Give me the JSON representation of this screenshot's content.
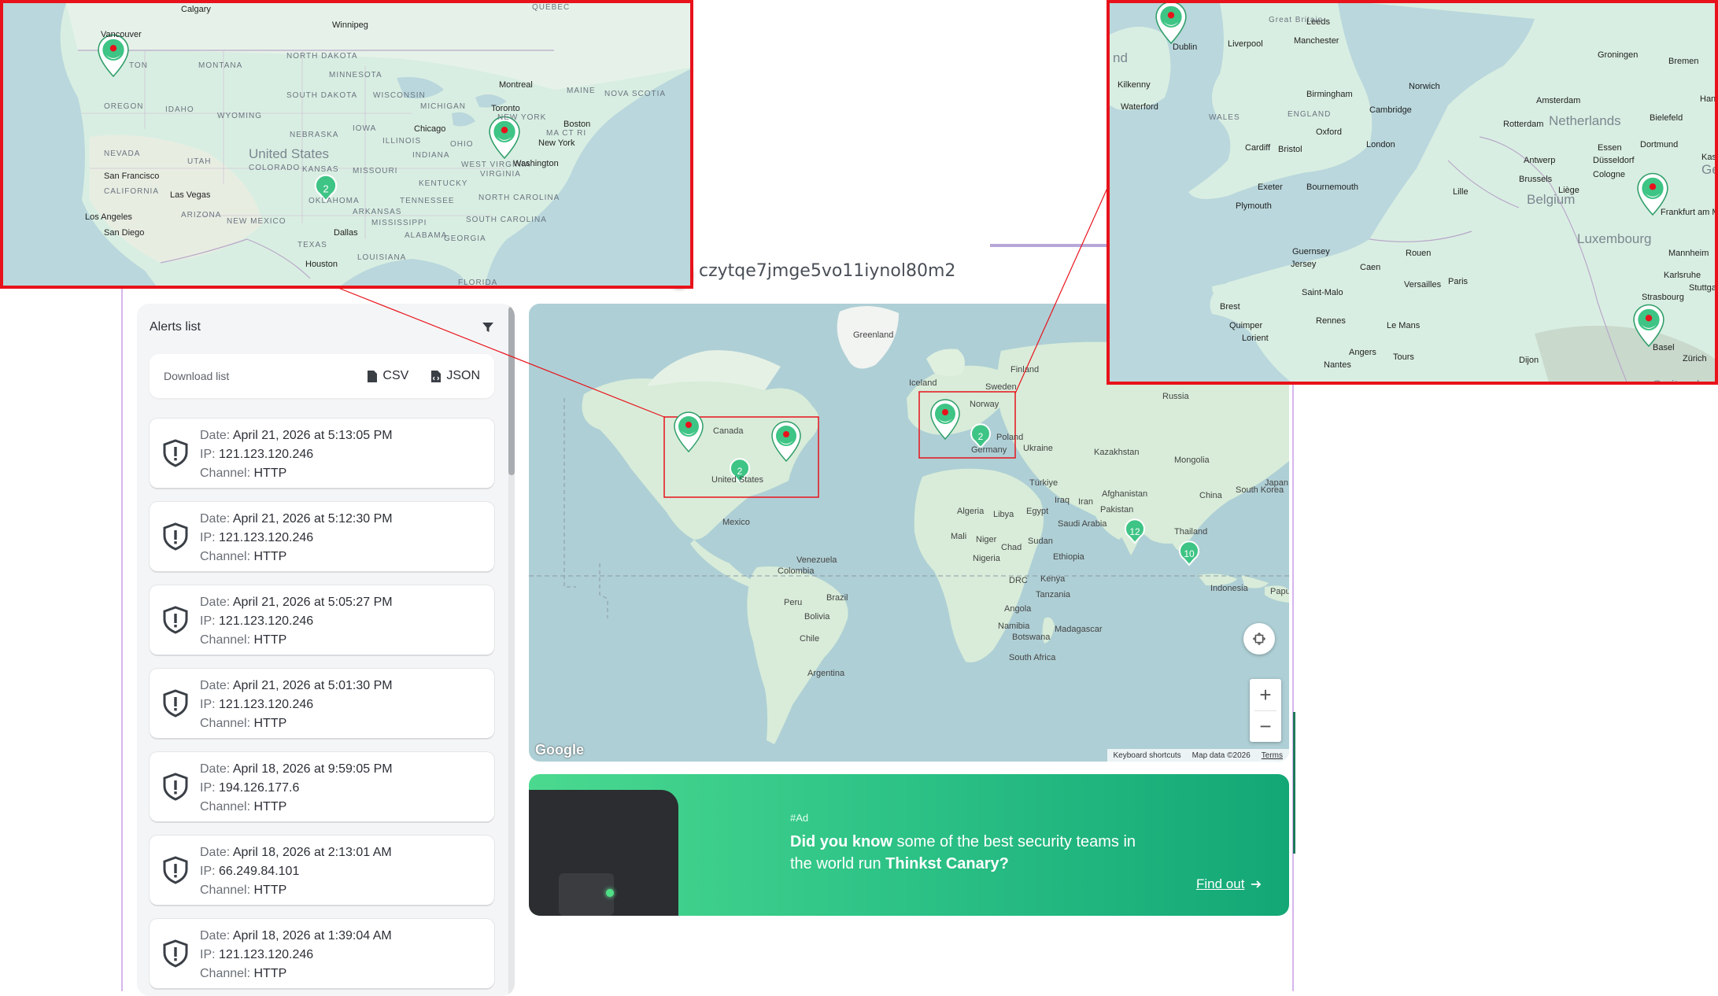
{
  "token": {
    "title": "czytqe7jmge5vo11iynol80m2"
  },
  "sidebar": {
    "title": "Alerts list",
    "download_label": "Download list",
    "csv_label": "CSV",
    "json_label": "JSON"
  },
  "alerts": [
    {
      "date": "April 21, 2026 at 5:13:05 PM",
      "ip": "121.123.120.246",
      "channel": "HTTP"
    },
    {
      "date": "April 21, 2026 at 5:12:30 PM",
      "ip": "121.123.120.246",
      "channel": "HTTP"
    },
    {
      "date": "April 21, 2026 at 5:05:27 PM",
      "ip": "121.123.120.246",
      "channel": "HTTP"
    },
    {
      "date": "April 21, 2026 at 5:01:30 PM",
      "ip": "121.123.120.246",
      "channel": "HTTP"
    },
    {
      "date": "April 18, 2026 at 9:59:05 PM",
      "ip": "194.126.177.6",
      "channel": "HTTP"
    },
    {
      "date": "April 18, 2026 at 2:13:01 AM",
      "ip": "66.249.84.101",
      "channel": "HTTP"
    },
    {
      "date": "April 18, 2026 at 1:39:04 AM",
      "ip": "121.123.120.246",
      "channel": "HTTP"
    }
  ],
  "alert_labels": {
    "date": "Date:",
    "ip": "IP:",
    "channel": "Channel:"
  },
  "map": {
    "footer_shortcuts": "Keyboard shortcuts",
    "footer_data": "Map data ©2026",
    "footer_terms": "Terms",
    "google": "Google",
    "zoom_in": "+",
    "zoom_out": "−",
    "clusters": [
      "2",
      "2",
      "12",
      "10"
    ],
    "labels": {
      "greenland": "Greenland",
      "iceland": "Iceland",
      "sweden": "Sweden",
      "finland": "Finland",
      "norway": "Norway",
      "russia": "Russia",
      "canada": "Canada",
      "united_states": "United States",
      "mexico": "Mexico",
      "kazakhstan": "Kazakhstan",
      "mongolia": "Mongolia",
      "ukraine": "Ukraine",
      "poland": "Poland",
      "germany": "Germany",
      "turkiye": "Türkiye",
      "iraq": "Iraq",
      "iran": "Iran",
      "afghanistan": "Afghanistan",
      "pakistan": "Pakistan",
      "china": "China",
      "south_korea": "South Korea",
      "japan": "Japan",
      "algeria": "Algeria",
      "libya": "Libya",
      "egypt": "Egypt",
      "saudi_arabia": "Saudi Arabia",
      "mali": "Mali",
      "niger": "Niger",
      "chad": "Chad",
      "sudan": "Sudan",
      "nigeria": "Nigeria",
      "ethiopia": "Ethiopia",
      "thailand": "Thailand",
      "venezuela": "Venezuela",
      "colombia": "Colombia",
      "peru": "Peru",
      "brazil": "Brazil",
      "bolivia": "Bolivia",
      "chile": "Chile",
      "argentina": "Argentina",
      "drc": "DRC",
      "kenya": "Kenya",
      "tanzania": "Tanzania",
      "angola": "Angola",
      "namibia": "Namibia",
      "botswana": "Botswana",
      "south_africa": "South Africa",
      "madagascar": "Madagascar",
      "indonesia": "Indonesia",
      "papua": "Papua"
    }
  },
  "inset_us": {
    "clusters": [
      "2"
    ],
    "labels": {
      "calgary": "Calgary",
      "winnipeg": "Winnipeg",
      "vancouver": "Vancouver",
      "quebec": "QUÉBEC",
      "north_dakota": "NORTH DAKOTA",
      "montana": "MONTANA",
      "minnesota": "MINNESOTA",
      "south_dakota": "SOUTH DAKOTA",
      "wisconsin": "WISCONSIN",
      "michigan": "MICHIGAN",
      "montreal": "Montreal",
      "maine": "MAINE",
      "nova_scotia": "NOVA SCOTIA",
      "oregon": "OREGON",
      "idaho": "IDAHO",
      "wyoming": "WYOMING",
      "toronto": "Toronto",
      "new_york_state": "NEW YORK",
      "boston": "Boston",
      "iowa": "IOWA",
      "chicago": "Chicago",
      "nebraska": "NEBRASKA",
      "illinois": "ILLINOIS",
      "ohio": "OHIO",
      "ma_ct_ri": "MA CT RI",
      "new_york": "New York",
      "nevada": "NEVADA",
      "utah": "UTAH",
      "colorado": "COLORADO",
      "united_states": "United States",
      "kansas": "KANSAS",
      "missouri": "MISSOURI",
      "indiana": "INDIANA",
      "west_virginia": "WEST VIRGINIA",
      "washington": "Washington",
      "virginia": "VIRGINIA",
      "san_francisco": "San Francisco",
      "california": "CALIFORNIA",
      "las_vegas": "Las Vegas",
      "oklahoma": "OKLAHOMA",
      "kentucky": "KENTUCKY",
      "tennessee": "TENNESSEE",
      "north_carolina": "NORTH CAROLINA",
      "arizona": "ARIZONA",
      "los_angeles": "Los Angeles",
      "new_mexico": "NEW MEXICO",
      "arkansas": "ARKANSAS",
      "mississippi": "MISSISSIPPI",
      "south_carolina": "SOUTH CAROLINA",
      "san_diego": "San Diego",
      "dallas": "Dallas",
      "alabama": "ALABAMA",
      "georgia": "GEORGIA",
      "texas": "TEXAS",
      "houston": "Houston",
      "louisiana": "LOUISIANA",
      "ton": "TON",
      "florida": "FLORIDA"
    }
  },
  "inset_eu": {
    "labels": {
      "leeds": "Leeds",
      "great_britain": "Great Britain",
      "dublin": "Dublin",
      "liverpool": "Liverpool",
      "manchester": "Manchester",
      "groningen": "Groningen",
      "bremen": "Bremen",
      "ireland_frag": "nd",
      "kilkenny": "Kilkenny",
      "norwich": "Norwich",
      "birmingham": "Birmingham",
      "amsterdam": "Amsterdam",
      "waterford": "Waterford",
      "cambridge": "Cambridge",
      "netherlands": "Netherlands",
      "wales": "WALES",
      "england": "ENGLAND",
      "rotterdam": "Rotterdam",
      "bielefeld": "Bielefeld",
      "oxford": "Oxford",
      "essen": "Essen",
      "dortmund": "Dortmund",
      "cardiff": "Cardiff",
      "bristol": "Bristol",
      "london": "London",
      "antwerp": "Antwerp",
      "dusseldorf": "Düsseldorf",
      "kassel": "Kassel",
      "brussels": "Brussels",
      "cologne": "Cologne",
      "germ_frag": "Germ",
      "exeter": "Exeter",
      "bournemouth": "Bournemouth",
      "lille": "Lille",
      "liege": "Liège",
      "belgium": "Belgium",
      "frankfurt": "Frankfurt am Main",
      "plymouth": "Plymouth",
      "luxembourg": "Luxembourg",
      "guernsey": "Guernsey",
      "jersey": "Jersey",
      "caen": "Caen",
      "rouen": "Rouen",
      "mannheim": "Mannheim",
      "karlsruhe": "Karlsruhe",
      "versailles": "Versailles",
      "paris": "Paris",
      "stuttgart": "Stuttgart",
      "saint_malo": "Saint-Malo",
      "strasbourg": "Strasbourg",
      "brest": "Brest",
      "rennes": "Rennes",
      "quimper": "Quimper",
      "le_mans": "Le Mans",
      "lorient": "Lorient",
      "basel": "Basel",
      "angers": "Angers",
      "tours": "Tours",
      "zurich": "Zürich",
      "nantes": "Nantes",
      "dijon": "Dijon",
      "switzerland": "Switzerland",
      "han_frag": "Han"
    }
  },
  "ad": {
    "tag": "#Ad",
    "lead_bold": "Did you know",
    "lead_rest": " some of the best security teams in the world run ",
    "brand": "Thinkst Canary?",
    "link": "Find out"
  },
  "colors": {
    "pin": "#3ec485",
    "pin_dot": "#e8121b",
    "inset_border": "#e8121b",
    "accent": "#2fc487"
  }
}
